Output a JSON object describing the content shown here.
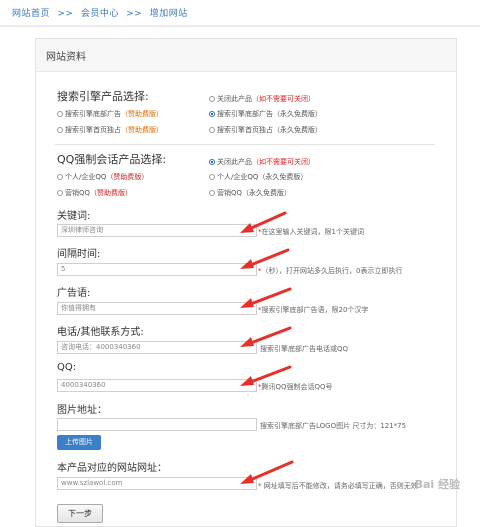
{
  "breadcrumb": {
    "home": "网站首页",
    "sep": ">>",
    "member": "会员中心",
    "current": "增加网站"
  },
  "panel": {
    "title": "网站资料"
  },
  "search_engine": {
    "title": "搜索引擎产品选择:",
    "options": [
      {
        "text": "搜索引擎底部广告",
        "tag": "（赞助费版）",
        "tag_color": "orange",
        "checked": false
      },
      {
        "text": "搜索引擎首页独占",
        "tag": "（赞助费版）",
        "tag_color": "orange",
        "checked": false
      },
      {
        "text": "关闭此产品",
        "tag": "（如不需要可关闭）",
        "tag_color": "red",
        "checked": false
      },
      {
        "text": "搜索引擎底部广告",
        "tag": "（永久免费版）",
        "tag_color": "gray",
        "checked": true
      },
      {
        "text": "搜索引擎首页独占",
        "tag": "（永久免费版）",
        "tag_color": "gray",
        "checked": false
      }
    ]
  },
  "qq": {
    "title": "QQ强制会话产品选择:",
    "options": [
      {
        "text": "个人/企业QQ",
        "tag": "（赞助费版）",
        "tag_color": "red",
        "checked": false
      },
      {
        "text": "营销QQ",
        "tag": "（赞助费版）",
        "tag_color": "red",
        "checked": false
      },
      {
        "text": "关闭此产品",
        "tag": "（如不需要可关闭）",
        "tag_color": "red",
        "checked": true
      },
      {
        "text": "个人/企业QQ",
        "tag": "（永久免费版）",
        "tag_color": "gray",
        "checked": false
      },
      {
        "text": "营销QQ",
        "tag": "（永久免费版）",
        "tag_color": "gray",
        "checked": false
      }
    ]
  },
  "fields": {
    "keyword": {
      "label": "关键词:",
      "value": "深圳律师咨询",
      "hint_star": "*",
      "hint": "在这里输入关键词，限1个关键词"
    },
    "interval": {
      "label": "间隔时间:",
      "value": "5",
      "hint_star": "*",
      "hint": "（秒），打开网站多久后执行，0表示立即执行"
    },
    "ad": {
      "label": "广告语:",
      "value": "你值得拥有",
      "hint_star": "*",
      "hint": "搜索引擎底部广告语，限20个汉字"
    },
    "phone": {
      "label": "电话/其他联系方式:",
      "value": "咨询电话：4000340360",
      "hint": "搜索引擎底部广告电话或QQ"
    },
    "qqnum": {
      "label": "QQ:",
      "value": "4000340360",
      "hint_star": "*",
      "hint": "腾讯QQ强制会话QQ号"
    },
    "image": {
      "label": "图片地址：",
      "value": "",
      "hint": "搜索引擎底部广告LOGO图片 尺寸为：121*75",
      "upload": "上传图片"
    },
    "site": {
      "label": "本产品对应的网站网址：",
      "value": "www.szlawol.com",
      "hint": "* 网址填写后不能修改，请务必填写正确，否则无效"
    }
  },
  "buttons": {
    "next": "下一步"
  },
  "colors": {
    "link": "#3a79b8",
    "red": "#dd2222",
    "orange": "#e06a00",
    "button": "#3b7fc8",
    "arrow": "#e8302a"
  },
  "watermark": "Bai 经验"
}
